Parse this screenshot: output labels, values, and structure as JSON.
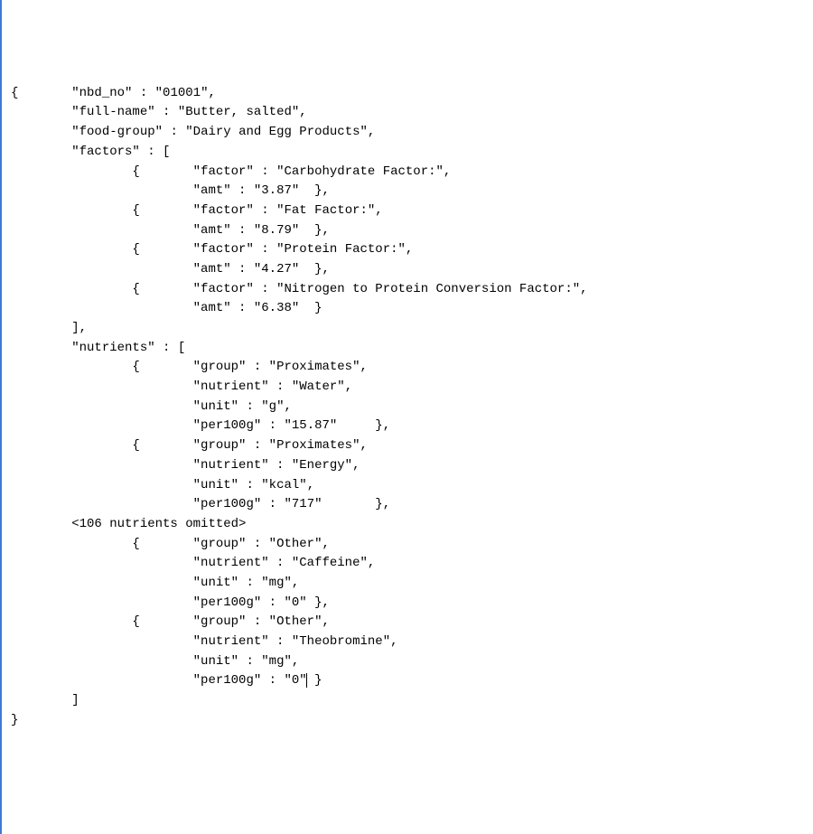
{
  "k_nbd_no": "\"nbd_no\"",
  "v_nbd_no": "\"01001\"",
  "k_full_name": "\"full-name\"",
  "v_full_name": "\"Butter, salted\"",
  "k_food_group": "\"food-group\"",
  "v_food_group": "\"Dairy and Egg Products\"",
  "k_factors": "\"factors\"",
  "k_factor": "\"factor\"",
  "k_amt": "\"amt\"",
  "f1_name": "\"Carbohydrate Factor:\"",
  "f1_amt": "\"3.87\"",
  "f2_name": "\"Fat Factor:\"",
  "f2_amt": "\"8.79\"",
  "f3_name": "\"Protein Factor:\"",
  "f3_amt": "\"4.27\"",
  "f4_name": "\"Nitrogen to Protein Conversion Factor:\"",
  "f4_amt": "\"6.38\"",
  "k_nutrients": "\"nutrients\"",
  "k_group": "\"group\"",
  "k_nutrient": "\"nutrient\"",
  "k_unit": "\"unit\"",
  "k_per100g": "\"per100g\"",
  "n1_group": "\"Proximates\"",
  "n1_nutrient": "\"Water\"",
  "n1_unit": "\"g\"",
  "n1_per100g": "\"15.87\"",
  "n2_group": "\"Proximates\"",
  "n2_nutrient": "\"Energy\"",
  "n2_unit": "\"kcal\"",
  "n2_per100g": "\"717\"",
  "omitted": "<106 nutrients omitted>",
  "n3_group": "\"Other\"",
  "n3_nutrient": "\"Caffeine\"",
  "n3_unit": "\"mg\"",
  "n3_per100g": "\"0\"",
  "n4_group": "\"Other\"",
  "n4_nutrient": "\"Theobromine\"",
  "n4_unit": "\"mg\"",
  "n4_per100g": "\"0\""
}
